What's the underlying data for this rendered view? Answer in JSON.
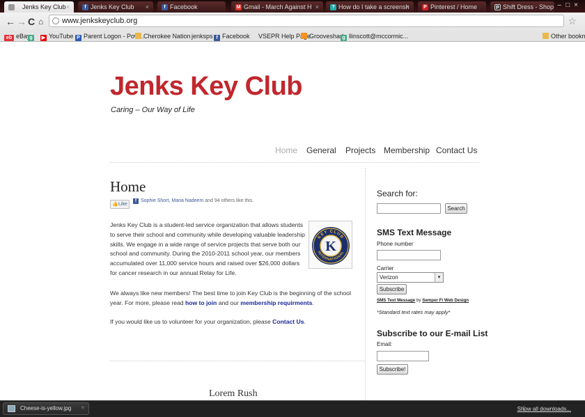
{
  "browser": {
    "tabs": [
      {
        "label": "Jenks Key Club",
        "icon": "page-icon",
        "active": true
      },
      {
        "label": "Jenks Key Club",
        "icon": "facebook-icon"
      },
      {
        "label": "Facebook",
        "icon": "facebook-icon"
      },
      {
        "label": "Gmail - March Against H",
        "icon": "gmail-icon"
      },
      {
        "label": "How do I take a screensh",
        "icon": "help-icon"
      },
      {
        "label": "Pinterest / Home",
        "icon": "pinterest-icon"
      },
      {
        "label": "Shift Dress - Shop for Shi",
        "icon": "shop-icon"
      }
    ],
    "url": "www.jenkskeyclub.org",
    "bookmarks": [
      {
        "label": "eBay",
        "icon": "ebay-icon"
      },
      {
        "label": "",
        "icon": "google-icon"
      },
      {
        "label": "YouTube",
        "icon": "youtube-icon"
      },
      {
        "label": "Parent Logon - Pow...",
        "icon": "powerschool-icon"
      },
      {
        "label": "Cherokee Nation",
        "icon": "folder-icon"
      },
      {
        "label": "jenksps",
        "icon": ""
      },
      {
        "label": "Facebook",
        "icon": "facebook-icon"
      },
      {
        "label": "VSEPR Help Page",
        "icon": ""
      },
      {
        "label": "Grooveshark",
        "icon": "grooveshark-icon"
      },
      {
        "label": "llinscott@mccormic...",
        "icon": "google-icon"
      },
      {
        "label": "Other bookmarks",
        "icon": "folder-icon"
      }
    ]
  },
  "site": {
    "title": "Jenks Key Club",
    "tagline": "Caring – Our Way of Life",
    "colors": {
      "title": "#c1272d",
      "link": "#1a2a9a"
    },
    "nav": [
      "Home",
      "General",
      "Projects",
      "Membership",
      "Contact Us"
    ],
    "nav_current": "Home"
  },
  "main": {
    "heading": "Home",
    "like": {
      "button": "Like",
      "names": "Sophie Short, Maria Nadeem",
      "rest": " and 94 others like this."
    },
    "paragraph1": "Jenks Key Club is a student-led service organization that allows students to serve their school and community while developing valuable leadership skills. We engage in a wide range of service projects that serve both our school and community. During the 2010-2011 school year, our members accumulated over 11,000 service hours and raised over $26,000 dollars for cancer research in our annual Relay for Life.",
    "paragraph2_pre": "We always like new members! The best time to join Key Club is the beginning of the school year. For more, please read ",
    "paragraph2_link1": "how to join",
    "paragraph2_mid": " and our ",
    "paragraph2_link2": "membership requirments",
    "paragraph2_post": ".",
    "paragraph3_pre": "If you would like us to volunteer for your organization, please ",
    "paragraph3_link": "Contact Us",
    "paragraph3_post": ".",
    "logo_text_top": "KEY CLUB",
    "logo_text_bottom": "INTERNATIONAL",
    "logo_letter": "K",
    "bottom_heading": "Lorem Rush"
  },
  "sidebar": {
    "search_heading": "Search for:",
    "search_button": "Search",
    "sms_heading": "SMS Text Message",
    "phone_label": "Phone number",
    "carrier_label": "Carrier",
    "carrier_selected": "Verizon",
    "subscribe_button": "Subscribe",
    "credit_link1": "SMS Text Message",
    "credit_by": " by ",
    "credit_link2": "Semper Fi Web Design",
    "rates_note": "*Standard text rates may apply*",
    "email_heading": "Subscribe to our E-mail List",
    "email_label": "Email:",
    "email_button": "Subscribe!"
  },
  "downloads": {
    "file": "Cheese-is-yellow.jpg",
    "show_all": "Show all downloads..."
  }
}
